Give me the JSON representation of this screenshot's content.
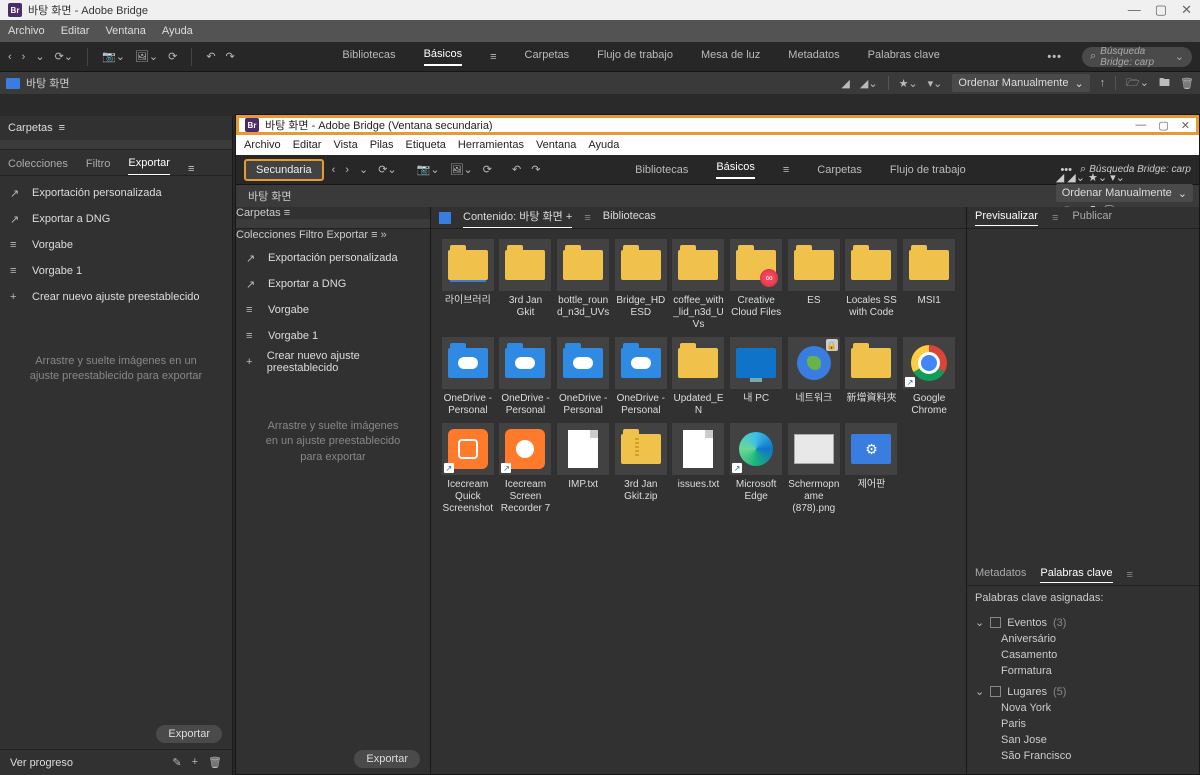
{
  "main_window": {
    "title": "바탕 화면 - Adobe Bridge",
    "menu": [
      "Archivo",
      "Editar",
      "Ventana",
      "Ayuda"
    ],
    "workspaces": [
      "Bibliotecas",
      "Básicos",
      "Carpetas",
      "Flujo de trabajo",
      "Mesa de luz",
      "Metadatos",
      "Palabras clave"
    ],
    "workspace_active": 1,
    "search_placeholder": "Búsqueda Bridge: carp",
    "path_label": "바탕 화면",
    "sort_label": "Ordenar Manualmente",
    "carpetas_label": "Carpetas",
    "left_tabs": [
      "Colecciones",
      "Filtro",
      "Exportar"
    ],
    "left_tab_active": 2,
    "export_items": [
      {
        "icon": "↗",
        "label": "Exportación personalizada"
      },
      {
        "icon": "↗",
        "label": "Exportar a DNG"
      },
      {
        "icon": "≡",
        "label": "Vorgabe"
      },
      {
        "icon": "≡",
        "label": "Vorgabe 1"
      },
      {
        "icon": "+",
        "label": "Crear nuevo ajuste preestablecido"
      }
    ],
    "drop_hint": "Arrastre y suelte imágenes en un ajuste preestablecido para exportar",
    "export_button": "Exportar",
    "progress_label": "Ver progreso"
  },
  "second_window": {
    "title": "바탕 화면 - Adobe Bridge (Ventana secundaria)",
    "menu": [
      "Archivo",
      "Editar",
      "Vista",
      "Pilas",
      "Etiqueta",
      "Herramientas",
      "Ventana",
      "Ayuda"
    ],
    "secondary_btn": "Secundaria",
    "workspaces": [
      "Bibliotecas",
      "Básicos",
      "Carpetas",
      "Flujo de trabajo"
    ],
    "workspace_active": 1,
    "search_placeholder": "Búsqueda Bridge: carp",
    "path_label": "바탕 화면",
    "sort_label": "Ordenar Manualmente",
    "carpetas_label": "Carpetas",
    "left_tabs": [
      "Colecciones",
      "Filtro",
      "Exportar"
    ],
    "left_tab_active": 2,
    "export_items": [
      {
        "icon": "↗",
        "label": "Exportación personalizada"
      },
      {
        "icon": "↗",
        "label": "Exportar a DNG"
      },
      {
        "icon": "≡",
        "label": "Vorgabe"
      },
      {
        "icon": "≡",
        "label": "Vorgabe 1"
      },
      {
        "icon": "+",
        "label": "Crear nuevo ajuste preestablecido"
      }
    ],
    "drop_hint": "Arrastre y suelte imágenes en un ajuste preestablecido para exportar",
    "export_button": "Exportar",
    "content_header": "Contenido: 바탕 화면",
    "content_plus": "+",
    "bibliotecas_tab": "Bibliotecas",
    "items": [
      {
        "type": "library",
        "label": "라이브러리"
      },
      {
        "type": "folder",
        "label": "3rd Jan Gkit"
      },
      {
        "type": "folder",
        "label": "bottle_round_n3d_UVs"
      },
      {
        "type": "folder",
        "label": "Bridge_HDESD"
      },
      {
        "type": "folder",
        "label": "coffee_with_lid_n3d_UVs"
      },
      {
        "type": "folder",
        "label": "Creative Cloud Files",
        "badge": "cc"
      },
      {
        "type": "folder",
        "label": "ES"
      },
      {
        "type": "folder",
        "label": "Locales SS with Code"
      },
      {
        "type": "folder",
        "label": "MSI1"
      },
      {
        "type": "cloud",
        "label": "OneDrive - Personal"
      },
      {
        "type": "cloud",
        "label": "OneDrive - Personal"
      },
      {
        "type": "cloud",
        "label": "OneDrive - Personal"
      },
      {
        "type": "cloud",
        "label": "OneDrive - Personal"
      },
      {
        "type": "folder",
        "label": "Updated_EN"
      },
      {
        "type": "monitor",
        "label": "내 PC"
      },
      {
        "type": "globe",
        "label": "네트워크",
        "badge": "lock"
      },
      {
        "type": "folder",
        "label": "新增資料夾"
      },
      {
        "type": "chrome",
        "label": "Google Chrome",
        "shortcut": true
      },
      {
        "type": "orange-cam",
        "label": "Icecream Quick Screenshot",
        "shortcut": true
      },
      {
        "type": "orange-rec",
        "label": "Icecream Screen Recorder 7",
        "shortcut": true
      },
      {
        "type": "file",
        "label": "IMP.txt"
      },
      {
        "type": "zip",
        "label": "3rd Jan Gkit.zip"
      },
      {
        "type": "file",
        "label": "issues.txt"
      },
      {
        "type": "edge",
        "label": "Microsoft Edge",
        "shortcut": true
      },
      {
        "type": "png",
        "label": "Schermopname (878).png"
      },
      {
        "type": "ctrl",
        "label": "제어판"
      }
    ],
    "right_tabs_top": [
      "Previsualizar",
      "Publicar"
    ],
    "right_tabs_top_active": 0,
    "right_tabs_bottom": [
      "Metadatos",
      "Palabras clave"
    ],
    "right_tabs_bottom_active": 1,
    "keywords_assigned": "Palabras clave asignadas:",
    "kw_groups": [
      {
        "name": "Eventos",
        "count": "(3)",
        "items": [
          "Aniversário",
          "Casamento",
          "Formatura"
        ]
      },
      {
        "name": "Lugares",
        "count": "(5)",
        "items": [
          "Nova York",
          "Paris",
          "San Jose",
          "São Francisco"
        ]
      }
    ]
  }
}
